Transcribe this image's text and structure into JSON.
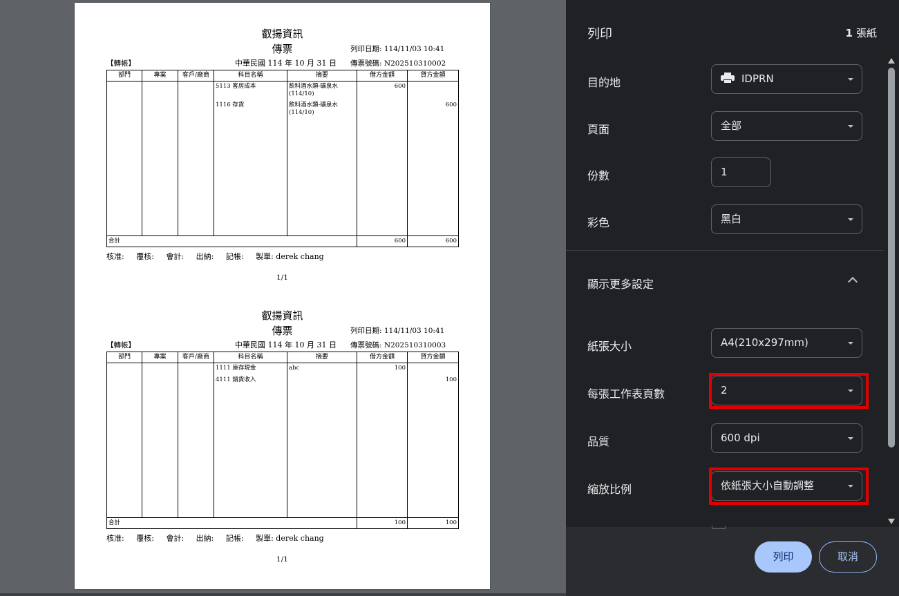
{
  "preview": {
    "vouchers": [
      {
        "company": "叡揚資訊",
        "title": "傳票",
        "print_date": "列印日期: 114/11/03 10:41",
        "type": "【轉帳】",
        "date": "中華民國 114 年 10 月 31 日",
        "number": "傳票號碼: N202510310002",
        "headers": [
          "部門",
          "專案",
          "客戶/廠商",
          "科目名稱",
          "摘要",
          "借方金額",
          "貸方金額"
        ],
        "entries": [
          {
            "account": "5113 客房成本",
            "memo": "飲料酒水類-礦泉水(114/10)",
            "debit": "600",
            "credit": ""
          },
          {
            "account": "1116 存貨",
            "memo": "飲料酒水類-礦泉水(114/10)",
            "debit": "",
            "credit": "600"
          }
        ],
        "total_label": "合計",
        "total_debit": "600",
        "total_credit": "600",
        "signatures": [
          "核准:",
          "覆核:",
          "會計:",
          "出納:",
          "記帳:"
        ],
        "maker": "製單: derek chang",
        "page": "1/1"
      },
      {
        "company": "叡揚資訊",
        "title": "傳票",
        "print_date": "列印日期: 114/11/03 10:41",
        "type": "【轉帳】",
        "date": "中華民國 114 年 10 月 31 日",
        "number": "傳票號碼: N202510310003",
        "headers": [
          "部門",
          "專案",
          "客戶/廠商",
          "科目名稱",
          "摘要",
          "借方金額",
          "貸方金額"
        ],
        "entries": [
          {
            "account": "1111 庫存現金",
            "memo": "abc",
            "debit": "100",
            "credit": ""
          },
          {
            "account": "4111 銷貨收入",
            "memo": "",
            "debit": "",
            "credit": "100"
          }
        ],
        "total_label": "合計",
        "total_debit": "100",
        "total_credit": "100",
        "signatures": [
          "核准:",
          "覆核:",
          "會計:",
          "出納:",
          "記帳:"
        ],
        "maker": "製單: derek chang",
        "page": "1/1"
      }
    ]
  },
  "panel": {
    "title": "列印",
    "sheet_count": "1",
    "sheet_unit": "張紙",
    "destination_label": "目的地",
    "destination_value": "IDPRN",
    "pages_label": "頁面",
    "pages_value": "全部",
    "copies_label": "份數",
    "copies_value": "1",
    "color_label": "彩色",
    "color_value": "黑白",
    "more_settings_label": "顯示更多設定",
    "paper_size_label": "紙張大小",
    "paper_size_value": "A4(210x297mm)",
    "pages_per_sheet_label": "每張工作表頁數",
    "pages_per_sheet_value": "2",
    "quality_label": "品質",
    "quality_value": "600 dpi",
    "scale_label": "縮放比例",
    "scale_value": "依紙張大小自動調整",
    "print_button": "列印",
    "cancel_button": "取消",
    "highlight_color": "#e00000",
    "accent_color": "#a8c7fa"
  }
}
